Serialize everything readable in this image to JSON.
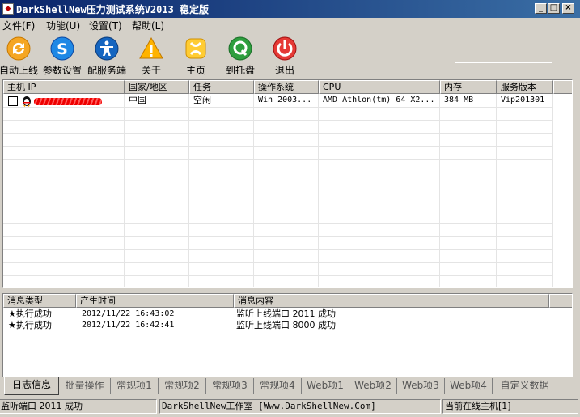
{
  "window": {
    "title": "DarkShellNew压力测试系统V2013 稳定版",
    "controls": [
      "_",
      "□",
      "×"
    ]
  },
  "menu": [
    "文件(F)",
    "功能(U)",
    "设置(T)",
    "帮助(L)"
  ],
  "toolbar": [
    {
      "label": "自动上线",
      "icon": "refresh-icon"
    },
    {
      "label": "参数设置",
      "icon": "skype-s-icon"
    },
    {
      "label": "配服务端",
      "icon": "accessibility-icon"
    },
    {
      "label": "关于",
      "icon": "warning-icon"
    },
    {
      "label": "主页",
      "icon": "home-icon"
    },
    {
      "label": "到托盘",
      "icon": "tray-icon"
    },
    {
      "label": "退出",
      "icon": "power-icon"
    }
  ],
  "hosts": {
    "columns": [
      "主机 IP",
      "国家/地区",
      "任务",
      "操作系统",
      "CPU",
      "内存",
      "服务版本"
    ],
    "rows": [
      {
        "ip": "",
        "country": "中国",
        "task": "空闲",
        "os": "Win 2003...",
        "cpu": "AMD Athlon(tm) 64 X2...",
        "memory": "384 MB",
        "version": "Vip201301"
      }
    ]
  },
  "log": {
    "columns": [
      "消息类型",
      "产生时间",
      "消息内容"
    ],
    "rows": [
      {
        "type": "★执行成功",
        "time": "2012/11/22 16:43:02",
        "message": "监听上线端口 2011 成功"
      },
      {
        "type": "★执行成功",
        "time": "2012/11/22 16:42:41",
        "message": "监听上线端口 8000 成功"
      }
    ]
  },
  "tabs": [
    "日志信息",
    "批量操作",
    "常规项1",
    "常规项2",
    "常规项3",
    "常规项4",
    "Web项1",
    "Web项2",
    "Web项3",
    "Web项4",
    "自定义数据"
  ],
  "status": {
    "left": "监听端口 2011 成功",
    "middle": "DarkShellNew工作室 [Www.DarkShellNew.Com]",
    "right": "当前在线主机[1]"
  }
}
